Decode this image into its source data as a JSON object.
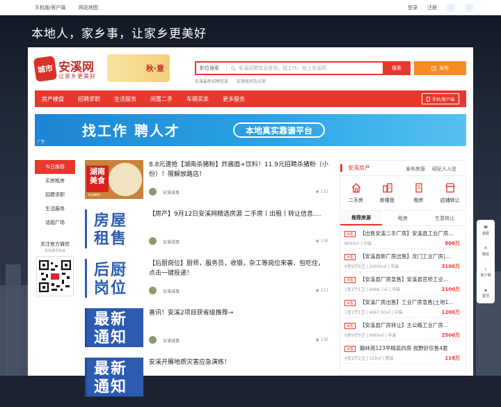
{
  "topbar": {
    "mobile": "手机版/客户端",
    "sitemap": "网站地图",
    "login": "登录",
    "register": "注册"
  },
  "slogan": "本地人，家乡事，让家乡更美好",
  "logo": {
    "badge": "城市",
    "name": "安溪网",
    "tagline": "让家乡更美好",
    "season": "秋·意"
  },
  "search": {
    "category": "职位搜索",
    "placeholder": "安溪招聘信息查询，找工作，就上安溪网",
    "button": "搜索",
    "hot": [
      "安溪最新招聘信息",
      "安溪租房及买卖"
    ]
  },
  "post_button": "发布",
  "nav": {
    "items": [
      "房产楼盘",
      "招聘求职",
      "生活服务",
      "闲置二手",
      "车辆买卖",
      "更多服务"
    ],
    "mobile": "手机/客户端"
  },
  "banner": {
    "title": "找工作 聘人才",
    "pill": "本地真实靠谱平台",
    "ad": "广告"
  },
  "leftmenu": [
    "今日推荐",
    "买房租房",
    "招聘求职",
    "生活服务",
    "话题广场"
  ],
  "follow": {
    "title": "关注官方微信",
    "sub": "本地事早知道"
  },
  "feed": [
    {
      "title": "8.8元速抢【湖南杀猪粉】炸酱面+饮料！11.9元招聘杀猪粉（小份）！限解放路店！",
      "author": "安溪城事",
      "views": "132",
      "thumb": {
        "a": "湖南美食",
        "b": "YUMMY"
      }
    },
    {
      "title": "【房产】9月12日安溪网精选房源 二手房丨出租丨转让信息....",
      "author": "安溪城事",
      "views": "136",
      "thumb": {
        "w": "房屋租售"
      }
    },
    {
      "title": "【后厨岗位】厨师，服务员，收银，杂工等岗位来袭，包吃住，点击一键投递！",
      "author": "安溪城事",
      "views": "113",
      "thumb": {
        "w": "后厨岗位"
      }
    },
    {
      "title": "喜讯！安溪2项目获省级推荐→",
      "author": "安溪城事",
      "views": "136",
      "thumb": {
        "w": "最新通知"
      }
    },
    {
      "title": "安溪开展地质灾害应急演练！",
      "author": "",
      "views": "",
      "thumb": {
        "w": "最新通知"
      }
    }
  ],
  "side": {
    "title": "安溪房产",
    "link1": "发布房源",
    "link2": "经纪人入驻",
    "icons": [
      "二手房",
      "新楼盘",
      "租房",
      "店铺转让"
    ],
    "tabs": [
      "推荐房源",
      "租房",
      "生意转让"
    ],
    "listings": [
      {
        "tag": "出售",
        "title": "【出售安溪二手厂房】安溪县工业厂房...",
        "sub": "8000㎡ | 中装",
        "price": "800万"
      },
      {
        "tag": "出售",
        "title": "【安溪县新厂房出售】龙门工业厂房|...",
        "sub": "9室9厅9卫 | 10000㎡ | 中装",
        "price": "3100万"
      },
      {
        "tag": "出售",
        "title": "【安溪县厂房急售】安溪县官桥工业...",
        "sub": "1室1厅1卫 | 6666.7㎡ | 中装",
        "price": "2100万"
      },
      {
        "tag": "出售",
        "title": "【安溪厂房出售】工业厂房急售|土地1...",
        "sub": "1室1厅1卫 | 4667.93㎡ | 中装",
        "price": "1200万"
      },
      {
        "tag": "出售",
        "title": "【安溪县厂房转让】主公路工业厂房...",
        "sub": "9室9厅9卫 | 9969㎡ | 中装",
        "price": "2500万"
      },
      {
        "tag": "出售",
        "title": "翰林苑123平精装四房 视野好仅售4套",
        "sub": "4室2厅2卫 | 123㎡ | 精装",
        "price": "118万"
      }
    ]
  },
  "float": [
    "客服",
    "微信",
    "客户端",
    "置顶"
  ]
}
